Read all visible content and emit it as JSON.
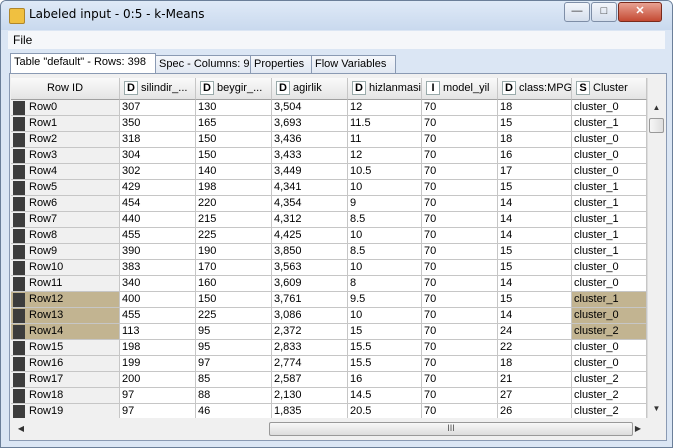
{
  "window": {
    "title": "Labeled input - 0:5 - k-Means"
  },
  "menu": {
    "file": "File"
  },
  "tabs": [
    {
      "label": "Table \"default\" - Rows: 398"
    },
    {
      "label": "Spec - Columns: 9"
    },
    {
      "label": "Properties"
    },
    {
      "label": "Flow Variables"
    }
  ],
  "table": {
    "columns": [
      {
        "label": "Row ID",
        "type": ""
      },
      {
        "label": "silindir_...",
        "type": "D"
      },
      {
        "label": "beygir_...",
        "type": "D"
      },
      {
        "label": "agirlik",
        "type": "D"
      },
      {
        "label": "hizlanmasi",
        "type": "D"
      },
      {
        "label": "model_yil",
        "type": "I"
      },
      {
        "label": "class:MPG",
        "type": "D"
      },
      {
        "label": "Cluster",
        "type": "S"
      }
    ],
    "rows": [
      [
        "Row0",
        "307",
        "130",
        "3,504",
        "12",
        "70",
        "18",
        "cluster_0"
      ],
      [
        "Row1",
        "350",
        "165",
        "3,693",
        "11.5",
        "70",
        "15",
        "cluster_1"
      ],
      [
        "Row2",
        "318",
        "150",
        "3,436",
        "11",
        "70",
        "18",
        "cluster_0"
      ],
      [
        "Row3",
        "304",
        "150",
        "3,433",
        "12",
        "70",
        "16",
        "cluster_0"
      ],
      [
        "Row4",
        "302",
        "140",
        "3,449",
        "10.5",
        "70",
        "17",
        "cluster_0"
      ],
      [
        "Row5",
        "429",
        "198",
        "4,341",
        "10",
        "70",
        "15",
        "cluster_1"
      ],
      [
        "Row6",
        "454",
        "220",
        "4,354",
        "9",
        "70",
        "14",
        "cluster_1"
      ],
      [
        "Row7",
        "440",
        "215",
        "4,312",
        "8.5",
        "70",
        "14",
        "cluster_1"
      ],
      [
        "Row8",
        "455",
        "225",
        "4,425",
        "10",
        "70",
        "14",
        "cluster_1"
      ],
      [
        "Row9",
        "390",
        "190",
        "3,850",
        "8.5",
        "70",
        "15",
        "cluster_1"
      ],
      [
        "Row10",
        "383",
        "170",
        "3,563",
        "10",
        "70",
        "15",
        "cluster_0"
      ],
      [
        "Row11",
        "340",
        "160",
        "3,609",
        "8",
        "70",
        "14",
        "cluster_0"
      ],
      [
        "Row12",
        "400",
        "150",
        "3,761",
        "9.5",
        "70",
        "15",
        "cluster_1"
      ],
      [
        "Row13",
        "455",
        "225",
        "3,086",
        "10",
        "70",
        "14",
        "cluster_0"
      ],
      [
        "Row14",
        "113",
        "95",
        "2,372",
        "15",
        "70",
        "24",
        "cluster_2"
      ],
      [
        "Row15",
        "198",
        "95",
        "2,833",
        "15.5",
        "70",
        "22",
        "cluster_0"
      ],
      [
        "Row16",
        "199",
        "97",
        "2,774",
        "15.5",
        "70",
        "18",
        "cluster_0"
      ],
      [
        "Row17",
        "200",
        "85",
        "2,587",
        "16",
        "70",
        "21",
        "cluster_2"
      ],
      [
        "Row18",
        "97",
        "88",
        "2,130",
        "14.5",
        "70",
        "27",
        "cluster_2"
      ],
      [
        "Row19",
        "97",
        "46",
        "1,835",
        "20.5",
        "70",
        "26",
        "cluster_2"
      ]
    ],
    "selected_rows": [
      "Row12",
      "Row13",
      "Row14"
    ]
  },
  "scrollbars": {
    "vertical_position": 0.0,
    "horizontal_grip": "III"
  }
}
